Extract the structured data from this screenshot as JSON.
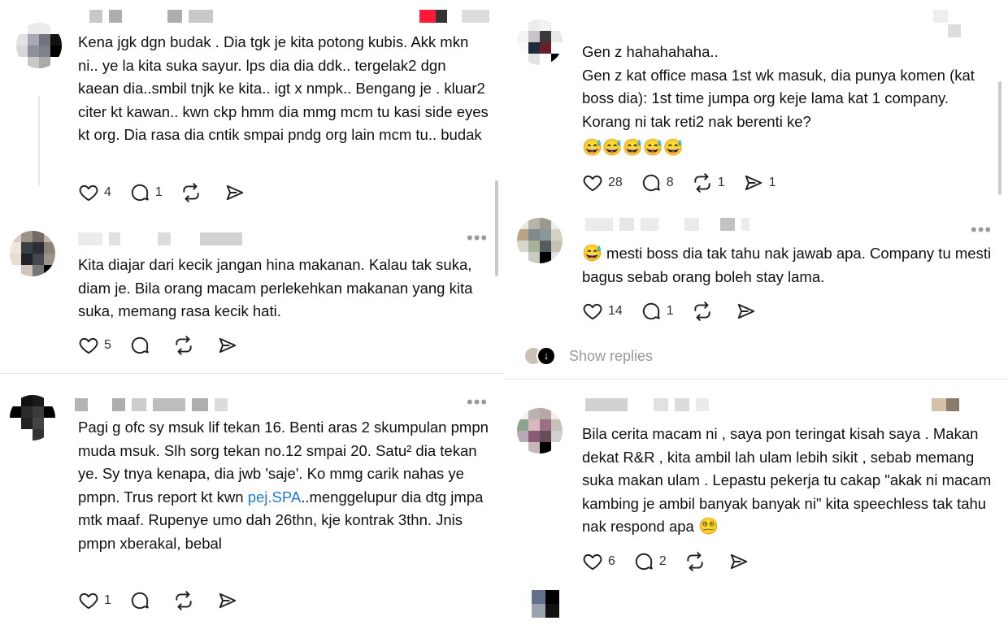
{
  "posts_left": [
    {
      "text": "Kena jgk dgn budak . Dia tgk je kita potong kubis. Akk mkn ni.. ye la kita suka sayur. lps dia dia ddk.. tergelak2 dgn kaean dia..smbil tnjk ke kita.. igt x nmpk.. Bengang je . kluar2 citer kt kawan.. kwn ckp hmm dia mmg mcm tu kasi side eyes kt org. Dia rasa dia cntik smpai pndg org lain mcm tu.. budak",
      "likes": "4",
      "replies": "1",
      "reposts": "",
      "shares": ""
    },
    {
      "text": "Kita diajar dari kecik jangan hina makanan. Kalau tak suka, diam je. Bila orang macam perlekehkan makanan yang kita suka, memang rasa kecik hati.",
      "likes": "5",
      "replies": "",
      "reposts": "",
      "shares": ""
    },
    {
      "text_part1": "Pagi g ofc sy msuk lif tekan 16. Benti aras 2 skumpulan pmpn muda msuk. Slh sorg tekan no.12 smpai 20. Satu² dia tekan ye. Sy tnya kenapa, dia jwb 'saje'. Ko mmg carik nahas ye pmpn. Trus report kt kwn ",
      "link": "pej.SPA",
      "text_part2": "..menggelupur dia dtg jmpa mtk maaf. Rupenye umo dah 26thn, kje kontrak 3thn. Jnis pmpn xberakal, bebal",
      "likes": "1",
      "replies": "",
      "reposts": "",
      "shares": ""
    }
  ],
  "posts_right": [
    {
      "text": "Gen z hahahahaha..\nGen z kat office masa 1st wk masuk, dia punya komen (kat boss dia): 1st time jumpa org keje lama kat 1 company. Korang ni tak reti2 nak berenti ke?",
      "emoji": "😅😅😅😅😅",
      "likes": "28",
      "replies": "8",
      "reposts": "1",
      "shares": "1"
    },
    {
      "emoji": "😅",
      "text": " mesti boss dia tak tahu nak jawab apa. Company tu mesti bagus sebab orang boleh stay lama.",
      "likes": "14",
      "replies": "1",
      "reposts": "",
      "shares": ""
    },
    {
      "show_replies": "Show replies"
    },
    {
      "text": "Bila cerita macam ni , saya pon teringat kisah saya . Makan dekat R&R , kita ambil lah ulam lebih sikit , sebab memang suka makan ulam . Lepastu pekerja tu cakap \"akak ni macam kambing je ambil banyak banyak ni\" kita speechless tak tahu nak respond apa",
      "emoji": "😵‍💫",
      "likes": "6",
      "replies": "2",
      "reposts": "",
      "shares": ""
    }
  ],
  "icons": [
    "heart-icon",
    "comment-icon",
    "repost-icon",
    "share-icon",
    "more-icon"
  ],
  "colors": {
    "text": "#111111",
    "muted": "#999999",
    "link": "#1f7bd3"
  }
}
